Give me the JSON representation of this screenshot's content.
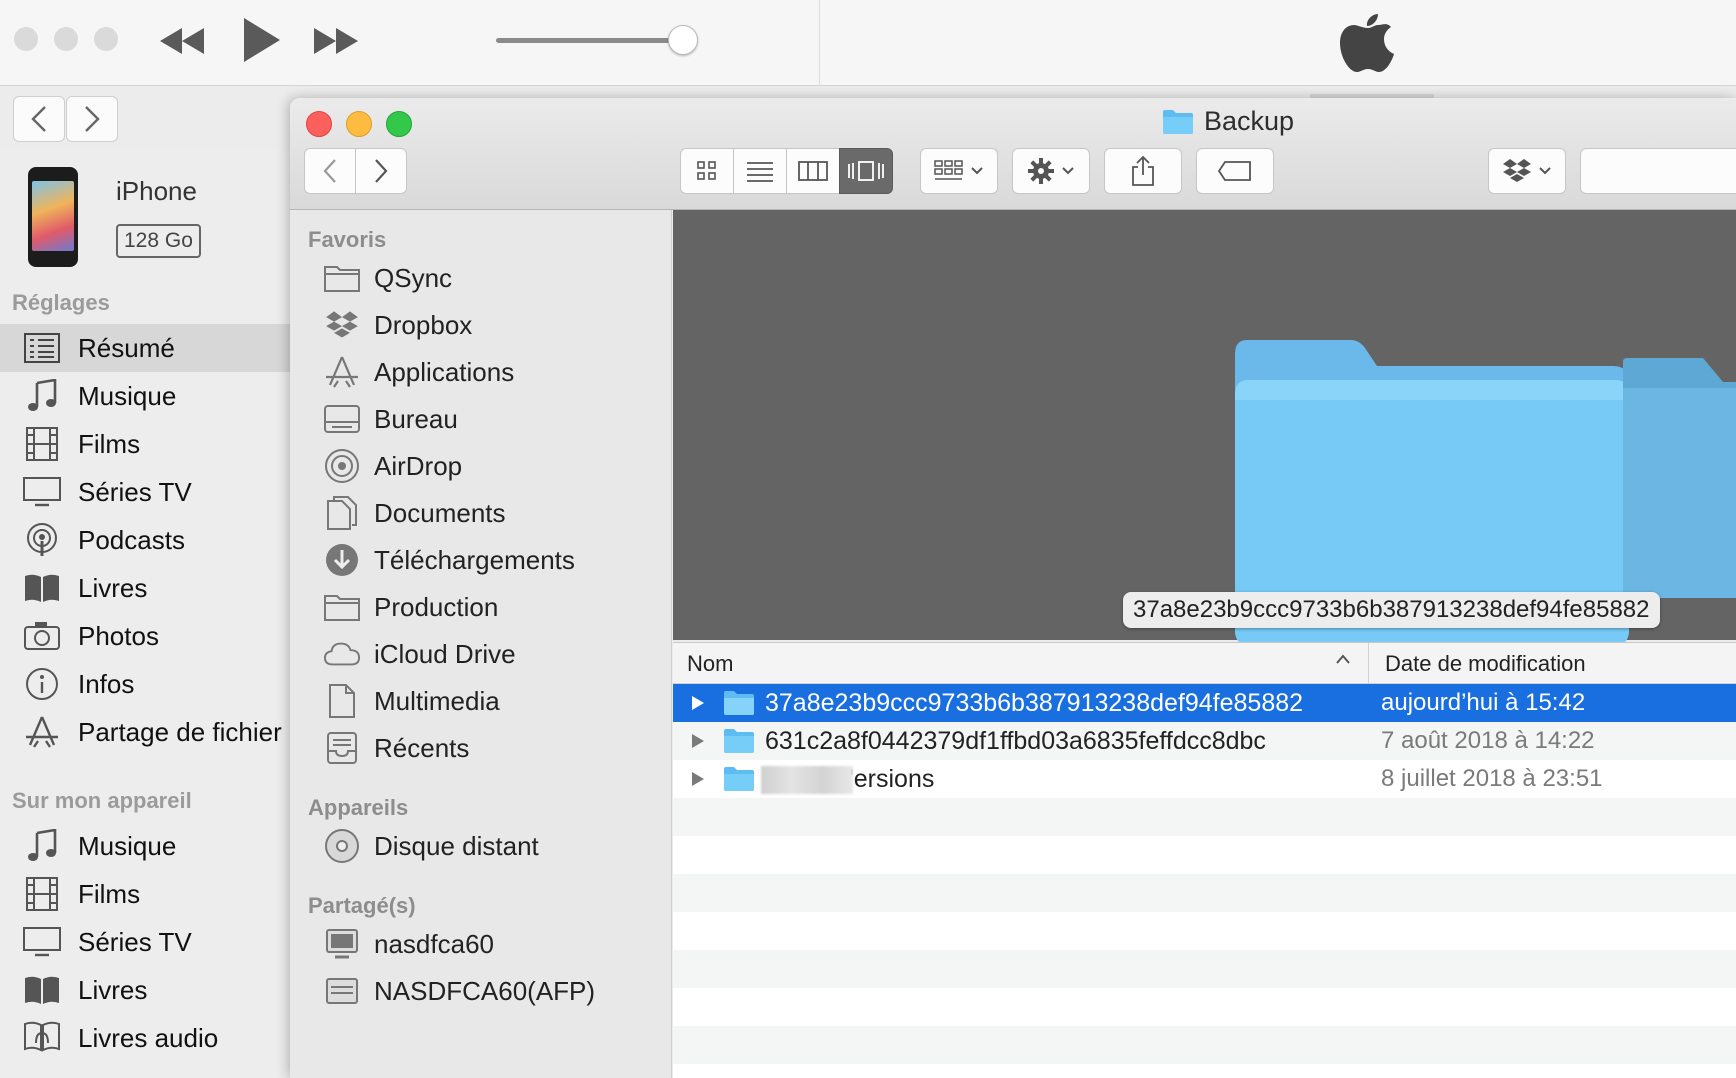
{
  "itunes": {
    "device": {
      "name": "iPhone",
      "capacity": "128 Go"
    },
    "sections": {
      "settings": "Réglages",
      "on_device": "Sur mon appareil"
    },
    "settings_items": [
      {
        "label": "Résumé",
        "icon": "summary-icon"
      },
      {
        "label": "Musique",
        "icon": "music-note-icon"
      },
      {
        "label": "Films",
        "icon": "film-icon"
      },
      {
        "label": "Séries TV",
        "icon": "tv-icon"
      },
      {
        "label": "Podcasts",
        "icon": "podcast-icon"
      },
      {
        "label": "Livres",
        "icon": "book-icon"
      },
      {
        "label": "Photos",
        "icon": "camera-icon"
      },
      {
        "label": "Infos",
        "icon": "info-icon"
      },
      {
        "label": "Partage de fichier",
        "icon": "app-store-icon"
      }
    ],
    "device_items": [
      {
        "label": "Musique",
        "icon": "music-note-icon"
      },
      {
        "label": "Films",
        "icon": "film-icon"
      },
      {
        "label": "Séries TV",
        "icon": "tv-icon"
      },
      {
        "label": "Livres",
        "icon": "book-icon"
      },
      {
        "label": "Livres audio",
        "icon": "audiobook-icon"
      }
    ],
    "selected_item": "Résumé",
    "volume_fraction": 0.9
  },
  "finder": {
    "title": "Backup",
    "view_mode_active": "cover-flow",
    "sidebar": {
      "favorites_title": "Favoris",
      "favorites": [
        {
          "label": "QSync",
          "icon": "folder-icon"
        },
        {
          "label": "Dropbox",
          "icon": "dropbox-icon"
        },
        {
          "label": "Applications",
          "icon": "applications-icon"
        },
        {
          "label": "Bureau",
          "icon": "desktop-icon"
        },
        {
          "label": "AirDrop",
          "icon": "airdrop-icon"
        },
        {
          "label": "Documents",
          "icon": "documents-icon"
        },
        {
          "label": "Téléchargements",
          "icon": "downloads-icon"
        },
        {
          "label": "Production",
          "icon": "folder-icon"
        },
        {
          "label": "iCloud Drive",
          "icon": "icloud-icon"
        },
        {
          "label": "Multimedia",
          "icon": "file-icon"
        },
        {
          "label": "Récents",
          "icon": "recents-icon"
        }
      ],
      "devices_title": "Appareils",
      "devices": [
        {
          "label": "Disque distant",
          "icon": "disc-icon"
        }
      ],
      "shared_title": "Partagé(s)",
      "shared": [
        {
          "label": "nasdfca60",
          "icon": "server-icon"
        },
        {
          "label": "NASDFCA60(AFP)",
          "icon": "server-icon"
        }
      ]
    },
    "preview_caption": "37a8e23b9ccc9733b6b387913238def94fe85882",
    "columns": {
      "name": "Nom",
      "date": "Date de modification"
    },
    "rows": [
      {
        "name": "37a8e23b9ccc9733b6b387913238def94fe85882",
        "date": "aujourd’hui à 15:42",
        "selected": true
      },
      {
        "name": "631c2a8f0442379df1ffbd03a6835feffdcc8dbc",
        "date": "7 août 2018 à 14:22",
        "selected": false
      },
      {
        "name": "'ersions",
        "date": "8 juillet 2018 à 23:51",
        "selected": false
      }
    ]
  },
  "colors": {
    "selection": "#1a6fe0",
    "folder_blue": "#6cc4f4",
    "close": "#fc605c",
    "minimize": "#fdbc40",
    "maximize": "#34c84a"
  }
}
